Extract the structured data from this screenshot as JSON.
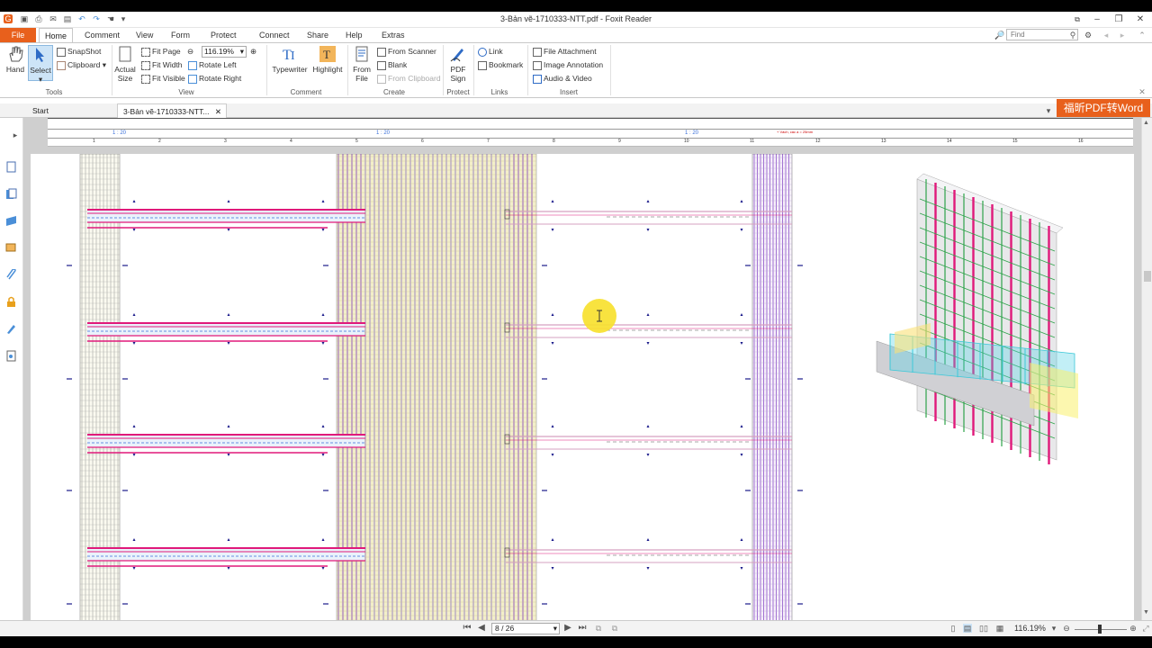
{
  "window": {
    "title": "3-Bản vẽ-1710333-NTT.pdf - Foxit Reader"
  },
  "menu": {
    "file": "File",
    "tabs": [
      "Home",
      "Comment",
      "View",
      "Form",
      "Protect",
      "Connect",
      "Share",
      "Help",
      "Extras"
    ],
    "find_placeholder": "Find"
  },
  "ribbon": {
    "tools": {
      "hand": "Hand",
      "select": "Select",
      "snapshot": "SnapShot",
      "clipboard": "Clipboard",
      "label": "Tools"
    },
    "view": {
      "actual_size_1": "Actual",
      "actual_size_2": "Size",
      "fit_page": "Fit Page",
      "fit_width": "Fit Width",
      "fit_visible": "Fit Visible",
      "zoom": "116.19%",
      "rotate_left": "Rotate Left",
      "rotate_right": "Rotate Right",
      "label": "View"
    },
    "comment": {
      "typewriter": "Typewriter",
      "highlight": "Highlight",
      "label": "Comment"
    },
    "create": {
      "from_file_1": "From",
      "from_file_2": "File",
      "from_scanner": "From Scanner",
      "blank": "Blank",
      "from_clipboard": "From Clipboard",
      "label": "Create"
    },
    "protect": {
      "pdf_sign_1": "PDF",
      "pdf_sign_2": "Sign",
      "label": "Protect"
    },
    "links": {
      "link": "Link",
      "bookmark": "Bookmark",
      "label": "Links"
    },
    "insert": {
      "file_attachment": "File Attachment",
      "image_annotation": "Image Annotation",
      "audio_video": "Audio & Video",
      "label": "Insert"
    }
  },
  "doc_tabs": {
    "start": "Start",
    "active": "3-Bản vẽ-1710333-NTT...",
    "promo": "福昕PDF转Word"
  },
  "drawing": {
    "scales": [
      "1 : 20",
      "1 : 20",
      "1 : 20"
    ],
    "note": "+ Vách, các a = 25mm",
    "ruler": [
      "1",
      "2",
      "3",
      "4",
      "5",
      "6",
      "7",
      "8",
      "9",
      "10",
      "11",
      "12",
      "13",
      "14",
      "15",
      "16"
    ]
  },
  "status": {
    "page": "8 / 26",
    "zoom": "116.19%"
  },
  "colors": {
    "accent": "#e8601c",
    "rebar_magenta": "#e0197a",
    "rebar_purple": "#6a1fb8",
    "rebar_blue": "#3a6fd8",
    "concrete_yellow": "#f3efc9",
    "cursor_highlight": "#f7e02a"
  }
}
